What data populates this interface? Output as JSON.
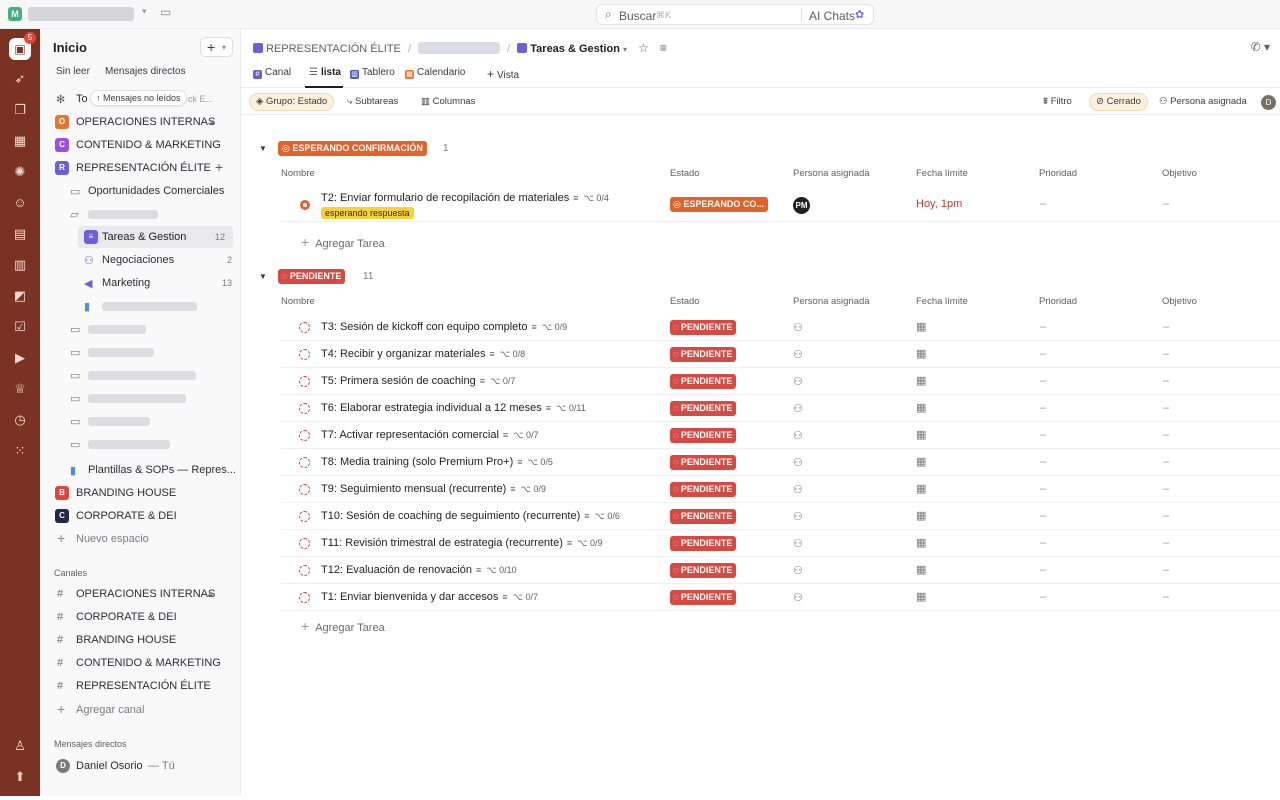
{
  "topbar": {
    "workspace_initial": "M",
    "search_label": "Buscar",
    "search_shortcut": "⌘K",
    "ai_label": "AI Chats"
  },
  "rail": {
    "home_badge": "5"
  },
  "sidebar": {
    "title": "Inicio",
    "filters": [
      "Sin leer",
      "Mensajes directos"
    ],
    "tooltip": "↑ Mensajes no leídos",
    "partial_row": "To",
    "partial_row_tail": "ck E...",
    "spaces": [
      {
        "label": "OPERACIONES INTERNAS",
        "color": "#e8742e",
        "initial": "O"
      },
      {
        "label": "CONTENIDO & MARKETING",
        "color": "#9b51e0",
        "initial": "C"
      },
      {
        "label": "REPRESENTACIÓN ÉLITE",
        "color": "#6c5fd8",
        "initial": "R"
      }
    ],
    "folder_oportunidades": "Oportunidades Comerciales",
    "lists": [
      {
        "label": "Tareas & Gestion",
        "count": "12"
      },
      {
        "label": "Negociaciones",
        "count": "2"
      },
      {
        "label": "Marketing",
        "count": "13"
      }
    ],
    "plantillas": "Plantillas & SOPs — Repres...",
    "spaces2": [
      {
        "label": "BRANDING HOUSE",
        "color": "#e0453a",
        "initial": "B"
      },
      {
        "label": "CORPORATE & DEI",
        "color": "#1f2a44",
        "initial": "C"
      }
    ],
    "nuevo_espacio": "Nuevo espacio",
    "channels_title": "Canales",
    "channels": [
      "OPERACIONES INTERNAS",
      "CORPORATE & DEI",
      "BRANDING HOUSE",
      "CONTENIDO & MARKETING",
      "REPRESENTACIÓN ÉLITE"
    ],
    "agregar_canal": "Agregar canal",
    "dm_title": "Mensajes directos",
    "dm_user": "Daniel Osorio",
    "dm_user_initial": "D",
    "dm_you": "— Tú"
  },
  "breadcrumb": {
    "space": "REPRESENTACIÓN ÉLITE",
    "list": "Tareas & Gestion"
  },
  "tabs": [
    "Canal",
    "lista",
    "Tablero",
    "Calendario",
    "Vista"
  ],
  "toolbar": {
    "group": "Grupo: Estado",
    "subtareas": "Subtareas",
    "columnas": "Columnas",
    "filtro": "Filtro",
    "cerrado": "Cerrado",
    "persona": "Persona asignada",
    "avatar": "D"
  },
  "columns": [
    "Nombre",
    "Estado",
    "Persona asignada",
    "Fecha límite",
    "Prioridad",
    "Objetivo"
  ],
  "group_waiting": {
    "label": "ESPERANDO CONFIRMACIÓN",
    "count": "1",
    "color": "#e0632e",
    "task": {
      "name": "T2: Enviar formulario de recopilación de materiales",
      "subtasks": "0/4",
      "tag": "esperando respuesta",
      "status": "ESPERANDO CO...",
      "assignee": "PM",
      "due": "Hoy, 1pm",
      "priority": "–",
      "objective": "–"
    }
  },
  "group_pending": {
    "label": "PENDIENTE",
    "count": "11",
    "color": "#d54a43",
    "status_label": "PENDIENTE",
    "dash": "–",
    "tasks": [
      {
        "name": "T3: Sesión de kickoff con equipo completo",
        "subtasks": "0/9"
      },
      {
        "name": "T4: Recibir y organizar materiales",
        "subtasks": "0/8"
      },
      {
        "name": "T5: Primera sesión de coaching",
        "subtasks": "0/7"
      },
      {
        "name": "T6: Elaborar estrategia individual a 12 meses",
        "subtasks": "0/11"
      },
      {
        "name": "T7: Activar representación comercial",
        "subtasks": "0/7"
      },
      {
        "name": "T8: Media training (solo Premium Pro+)",
        "subtasks": "0/5"
      },
      {
        "name": "T9: Seguimiento mensual (recurrente)",
        "subtasks": "0/9"
      },
      {
        "name": "T10: Sesión de coaching de seguimiento (recurrente)",
        "subtasks": "0/6"
      },
      {
        "name": "T11: Revisión trimestral de estrategia (recurrente)",
        "subtasks": "0/9"
      },
      {
        "name": "T12: Evaluación de renovación",
        "subtasks": "0/10"
      },
      {
        "name": "T1: Enviar bienvenida y dar accesos",
        "subtasks": "0/7"
      }
    ]
  },
  "add_task": "Agregar Tarea"
}
